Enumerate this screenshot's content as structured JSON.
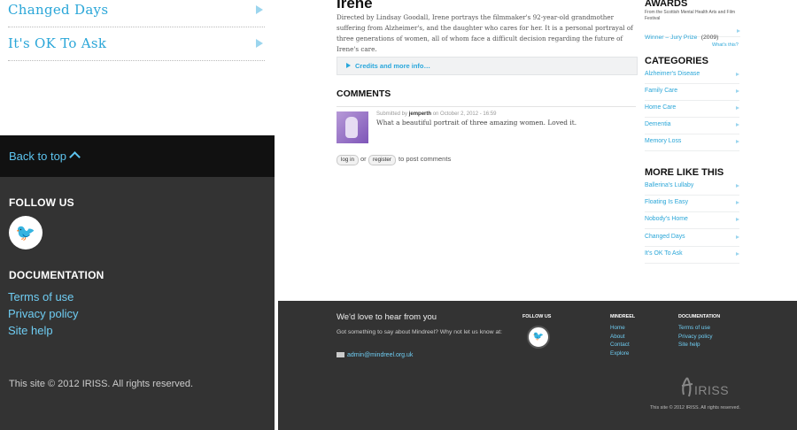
{
  "mobile": {
    "items": [
      {
        "label": "Changed Days"
      },
      {
        "label": "It's OK To Ask"
      }
    ],
    "back_to_top": "Back to top",
    "follow_us": "FOLLOW US",
    "twitter_icon": "twitter-icon",
    "documentation": "DOCUMENTATION",
    "links": [
      "Terms of use",
      "Privacy policy",
      "Site help"
    ],
    "copyright": "This site © 2012 IRISS. All rights reserved."
  },
  "film": {
    "title": "Irene",
    "description": "Directed by Lindsay Goodall, Irene portrays the filmmaker's 92-year-old grandmother suffering from Alzheimer's, and the daughter who cares for her. It is a personal portrayal of three generations of women, all of whom face a difficult decision regarding the future of Irene's care.",
    "credits_label": "Credits and more info…"
  },
  "comments": {
    "heading": "COMMENTS",
    "items": [
      {
        "meta_prefix": "Submitted by",
        "author": "jemperth",
        "meta_suffix": "on October 2, 2012 - 16:59",
        "text": "What a beautiful portrait of three amazing women. Loved it."
      }
    ],
    "login_label": "log in",
    "or": "or",
    "register_label": "register",
    "post_suffix": "to post comments"
  },
  "sidebar": {
    "awards_heading": "AWARDS",
    "awards_org": "From the Scottish Mental Health Arts and Film Festival",
    "award_title": "Winner – Jury Prize",
    "award_year": "(2009)",
    "whats_this": "What's this?",
    "categories_heading": "CATEGORIES",
    "categories": [
      "Alzheimer's Disease",
      "Family Care",
      "Home Care",
      "Dementia",
      "Memory Loss"
    ],
    "more_heading": "MORE LIKE THIS",
    "more": [
      "Ballerina's Lullaby",
      "Floating Is Easy",
      "Nobody's Home",
      "Changed Days",
      "It's OK To Ask"
    ]
  },
  "footer": {
    "love": "We'd love to hear from you",
    "got_something": "Got something to say about Mindreel? Why not let us know at:",
    "email": "admin@mindreel.org.uk",
    "follow_us": "FOLLOW US",
    "mindreel_heading": "MINDREEL",
    "mindreel_links": [
      "Home",
      "About",
      "Contact",
      "Explore"
    ],
    "documentation_heading": "DOCUMENTATION",
    "documentation_links": [
      "Terms of use",
      "Privacy policy",
      "Site help"
    ],
    "logo_text": "IRISS",
    "copyright": "This site © 2012 IRISS. All rights reserved."
  },
  "colors": {
    "accent": "#2aa6d8",
    "footer_bg": "#333333",
    "back_to_top_bg": "#111111"
  }
}
